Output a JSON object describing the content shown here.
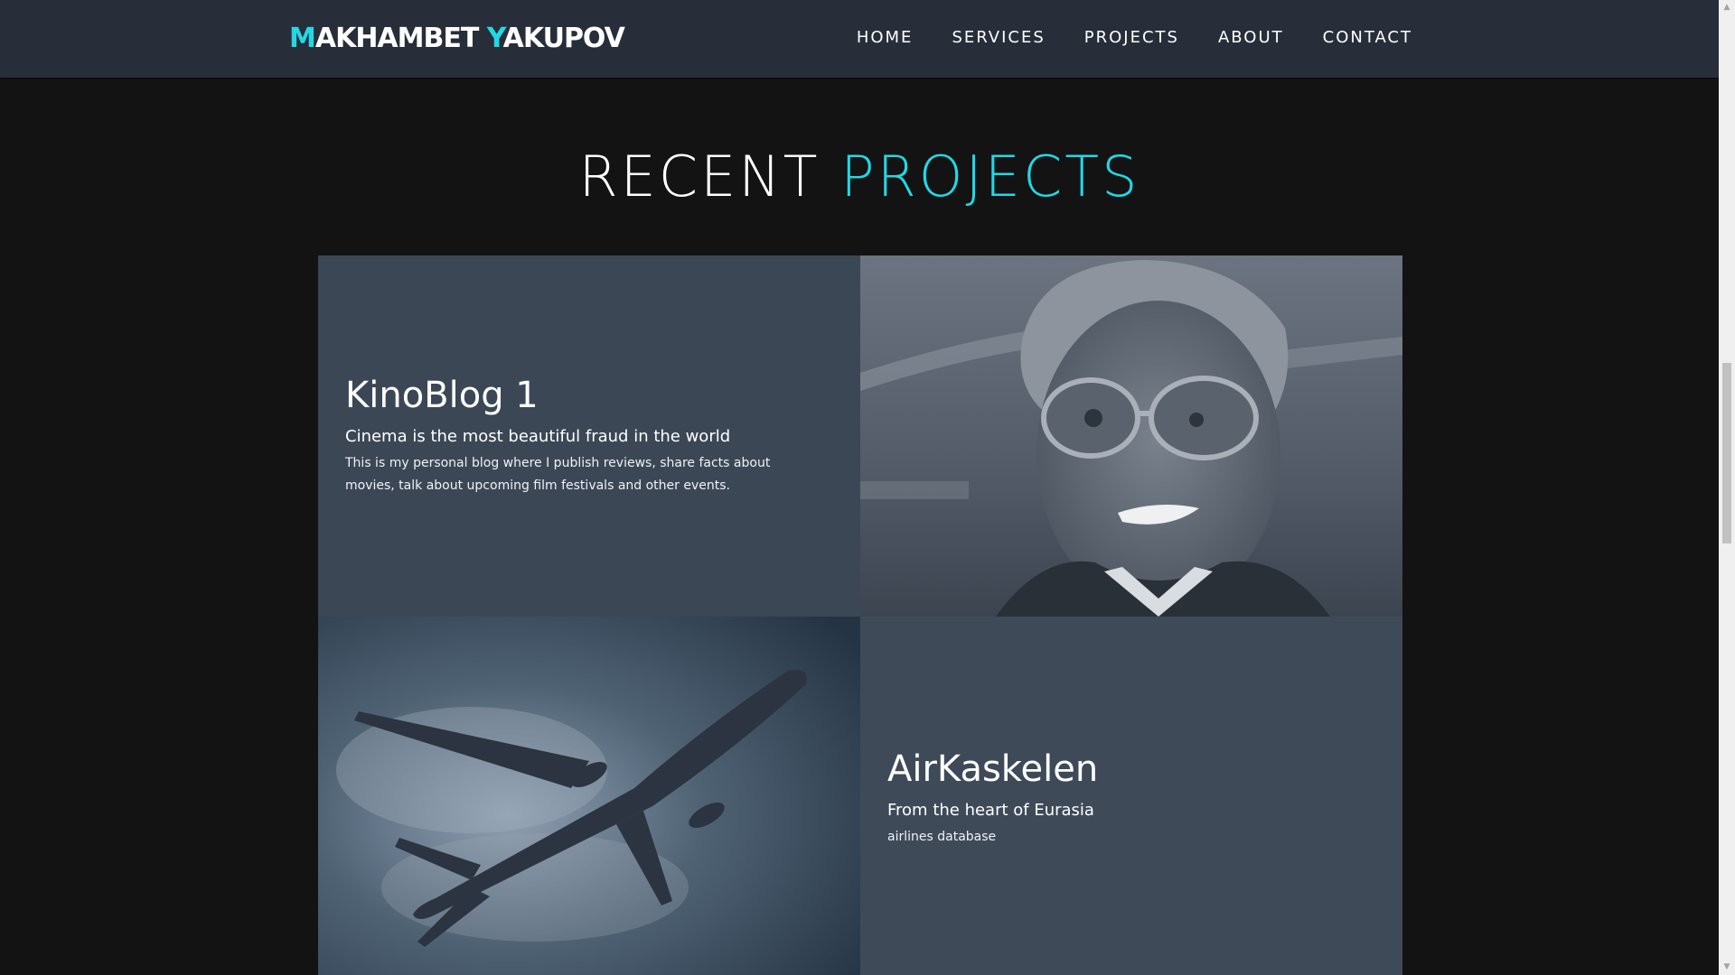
{
  "header": {
    "logo_first_initial": "M",
    "logo_first_rest": "AKHAMBET",
    "logo_last_initial": "Y",
    "logo_last_rest": "AKUPOV",
    "nav": [
      "HOME",
      "SERVICES",
      "PROJECTS",
      "ABOUT",
      "CONTACT"
    ]
  },
  "section": {
    "title_plain": "RECENT",
    "title_accent": "PROJECTS"
  },
  "projects": [
    {
      "title": "KinoBlog 1",
      "subtitle": "Cinema is the most beautiful fraud in the world",
      "description_line1": "This is my personal blog where I publish reviews, share facts about",
      "description_line2": "movies, talk about upcoming film festivals and other events."
    },
    {
      "title": "AirKaskelen",
      "subtitle": "From the heart of Eurasia",
      "description": "airlines database"
    }
  ],
  "images": {
    "project1_image": "black-and-white film still of a smiling man with glasses",
    "project2_image": "airplane silhouette against cloudy sky"
  },
  "colors": {
    "accent": "#22d8e6",
    "navbar_bg": "#272e3a",
    "page_bg": "#131313",
    "card_bg": "#3c4756"
  }
}
